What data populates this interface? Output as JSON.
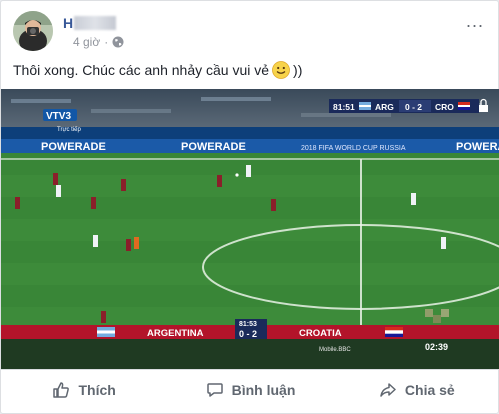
{
  "post": {
    "author_prefix": "H",
    "time": "4 giờ",
    "more_icon": "...",
    "text": "Thôi xong. Chúc các anh nhảy cầu vui vẻ",
    "text_suffix": "))",
    "emoji": "slightly-smiling-face"
  },
  "video": {
    "channel_logo": "VTV3",
    "channel_sub": "Trực tiếp",
    "scoreboard_time": "81:51",
    "home_team_short": "ARG",
    "away_team_short": "CRO",
    "score": "0 - 2",
    "ad_board_1": "POWERADE",
    "ad_board_2": "POWERADE",
    "ad_board_3": "2018 FIFA WORLD CUP RUSSIA",
    "ad_board_4": "POWERADE",
    "lower_time": "81:53",
    "lower_score": "0 - 2",
    "home_team": "ARGENTINA",
    "away_team": "CROATIA",
    "caption": "Mobile.BBC",
    "clock": "02:39",
    "colors": {
      "grass": "#3d8b3a",
      "lower_bar": "#b3142a",
      "score_box": "#1a2a5a"
    }
  },
  "actions": {
    "like": "Thích",
    "comment": "Bình luận",
    "share": "Chia sẻ"
  }
}
